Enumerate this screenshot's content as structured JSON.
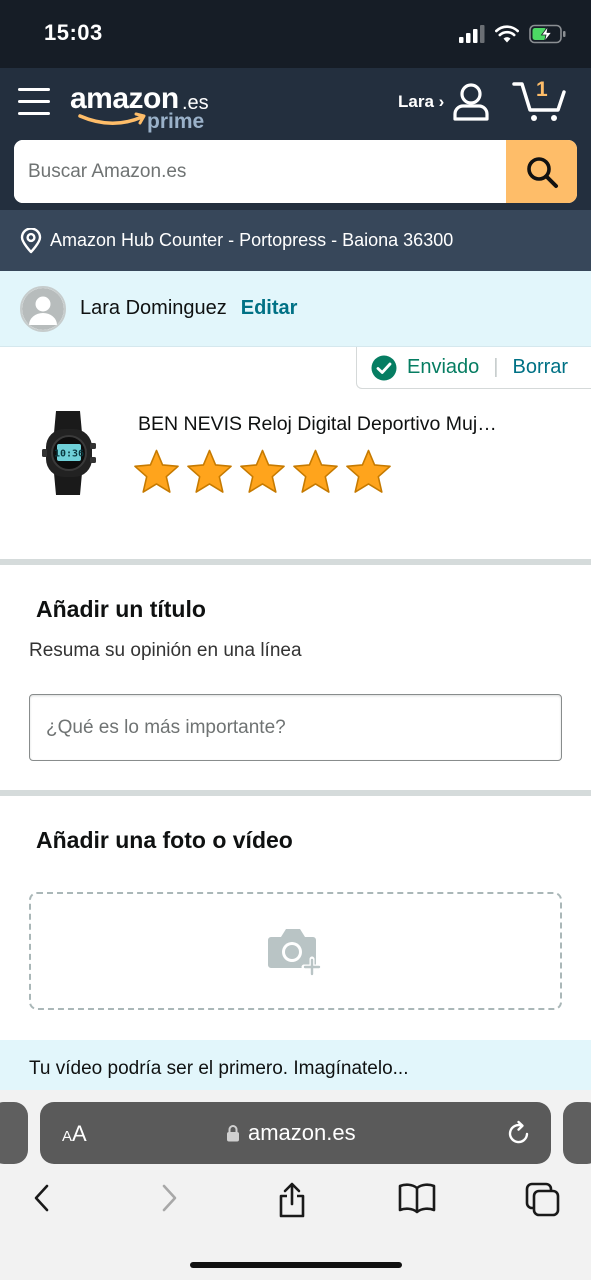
{
  "status_bar": {
    "time": "15:03"
  },
  "header": {
    "logo_word": "amazon",
    "logo_tld": ".es",
    "logo_prime": "prime",
    "account_label": "Lara ›",
    "cart_count": "1",
    "search_placeholder": "Buscar Amazon.es"
  },
  "location": {
    "text": "Amazon Hub Counter - Portopress - Baiona 36300"
  },
  "reviewer": {
    "name": "Lara Dominguez",
    "edit_label": "Editar"
  },
  "product": {
    "status_label": "Enviado",
    "separator": "|",
    "delete_label": "Borrar",
    "title": "BEN NEVIS Reloj Digital Deportivo Muj…",
    "watch_display": "10:36",
    "rating": 5,
    "rating_max": 5
  },
  "title_section": {
    "heading": "Añadir un título",
    "subheading": "Resuma su opinión en una línea",
    "input_placeholder": "¿Qué es lo más importante?"
  },
  "media_section": {
    "heading": "Añadir una foto o vídeo"
  },
  "video_banner": {
    "text": "Tu vídeo podría ser el primero. Imagínatelo..."
  },
  "browser": {
    "aa_small": "A",
    "aa_large": "A",
    "url": "amazon.es"
  },
  "colors": {
    "header_bg": "#232f3e",
    "location_bg": "#37475a",
    "search_button": "#febd69",
    "link": "#007185",
    "success": "#067d62",
    "star": "#ffa41c",
    "banner_bg": "#e2f6fb"
  }
}
